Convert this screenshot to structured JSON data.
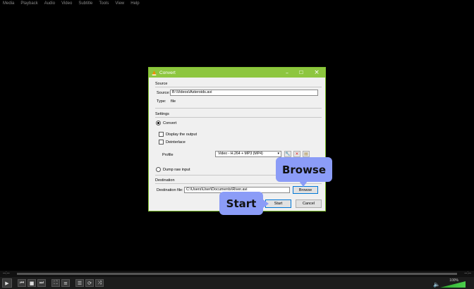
{
  "menubar": {
    "items": [
      "Media",
      "Playback",
      "Audio",
      "Video",
      "Subtitle",
      "Tools",
      "View",
      "Help"
    ]
  },
  "seek": {
    "elapsed": "--:--",
    "total": "--:--"
  },
  "controls": {
    "icons": [
      "play-icon",
      "previous-icon",
      "stop-icon",
      "next-icon",
      "fullscreen-icon",
      "extended-settings-icon",
      "playlist-icon",
      "loop-icon",
      "shuffle-icon"
    ],
    "volume_label": "100%",
    "volume_level": 1.0
  },
  "dialog": {
    "title": "Convert",
    "source_section": "Source",
    "source_label": "Source:",
    "source_value": "B:\\Videos\\Asteroids.avi",
    "type_label": "Type:",
    "type_value": "file",
    "settings_section": "Settings",
    "convert_label": "Convert",
    "display_output_label": "Display the output",
    "deinterlace_label": "Deinterlace",
    "profile_label": "Profile",
    "profile_value": "Video - H.264 + MP3 (MP4)",
    "dump_raw_label": "Dump raw input",
    "destination_section": "Destination",
    "dest_file_label": "Destination file:",
    "dest_file_value": "C:\\Users\\User\\Documents\\River.avi",
    "browse_label": "Browse",
    "start_label": "Start",
    "cancel_label": "Cancel"
  },
  "callouts": {
    "browse": "Browse",
    "start": "Start"
  },
  "colors": {
    "titlebar": "#8dc63f",
    "callout": "#8b9cf7",
    "volume": "#3cbf3c"
  }
}
